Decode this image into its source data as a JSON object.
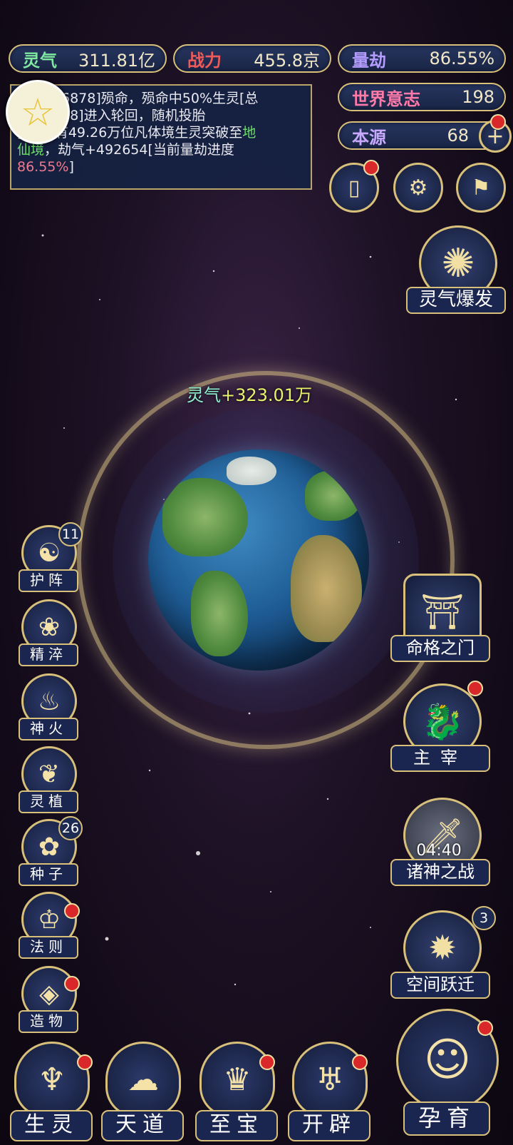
{
  "stats": {
    "lingqi": {
      "label": "灵气",
      "value": "311.81亿"
    },
    "zhanli": {
      "label": "战力",
      "value": "455.8京"
    },
    "liangjie": {
      "label": "量劫",
      "value": "86.55%"
    },
    "shijie": {
      "label": "世界意志",
      "value": "198"
    },
    "benyuan": {
      "label": "本源",
      "value": "68"
    }
  },
  "log": {
    "line1": "6878]殒命，殒命中50%生灵[总",
    "line2": "38]进入轮回，随机投胎",
    "line3_a": "[天族]有49.26万位凡体境生灵突破至",
    "line3_green1": "地",
    "line4_green": "仙境",
    "line4_b": "，劫气+492654[当前量劫进度",
    "line5_red": "86.55%",
    "line5_b": "]"
  },
  "burst": {
    "label": "灵气爆发"
  },
  "gain": {
    "key": "灵气",
    "value": "+323.01万"
  },
  "left_buttons": [
    {
      "label": "护阵",
      "badge": "11",
      "icon": "yin-yang-icon"
    },
    {
      "label": "精淬",
      "icon": "lotus-flame-icon"
    },
    {
      "label": "神火",
      "icon": "fire-icon"
    },
    {
      "label": "灵植",
      "icon": "plant-icon"
    },
    {
      "label": "种子",
      "badge": "26",
      "icon": "seed-flower-icon"
    },
    {
      "label": "法则",
      "icon": "law-beast-icon"
    },
    {
      "label": "造物",
      "icon": "diamond-rune-icon"
    }
  ],
  "right_buttons": [
    {
      "label": "命格之门",
      "icon": "gate-icon"
    },
    {
      "label": "主宰",
      "icon": "dragon-icon"
    },
    {
      "label": "诸神之战",
      "timer": "04:40",
      "icon": "sword-wings-icon"
    },
    {
      "label": "空间跃迁",
      "badge": "3",
      "icon": "vortex-icon"
    }
  ],
  "bottom_buttons": [
    {
      "label": "生灵",
      "icon": "phoenix-icon"
    },
    {
      "label": "天道",
      "icon": "cloud-swirl-icon"
    },
    {
      "label": "至宝",
      "icon": "treasure-icon"
    },
    {
      "label": "开辟",
      "icon": "flame-axe-icon"
    },
    {
      "label": "孕育",
      "icon": "embryo-icon"
    }
  ],
  "colors": {
    "gold": "#d8c07a",
    "panel": "#1a2650",
    "alert": "#d8282a"
  }
}
